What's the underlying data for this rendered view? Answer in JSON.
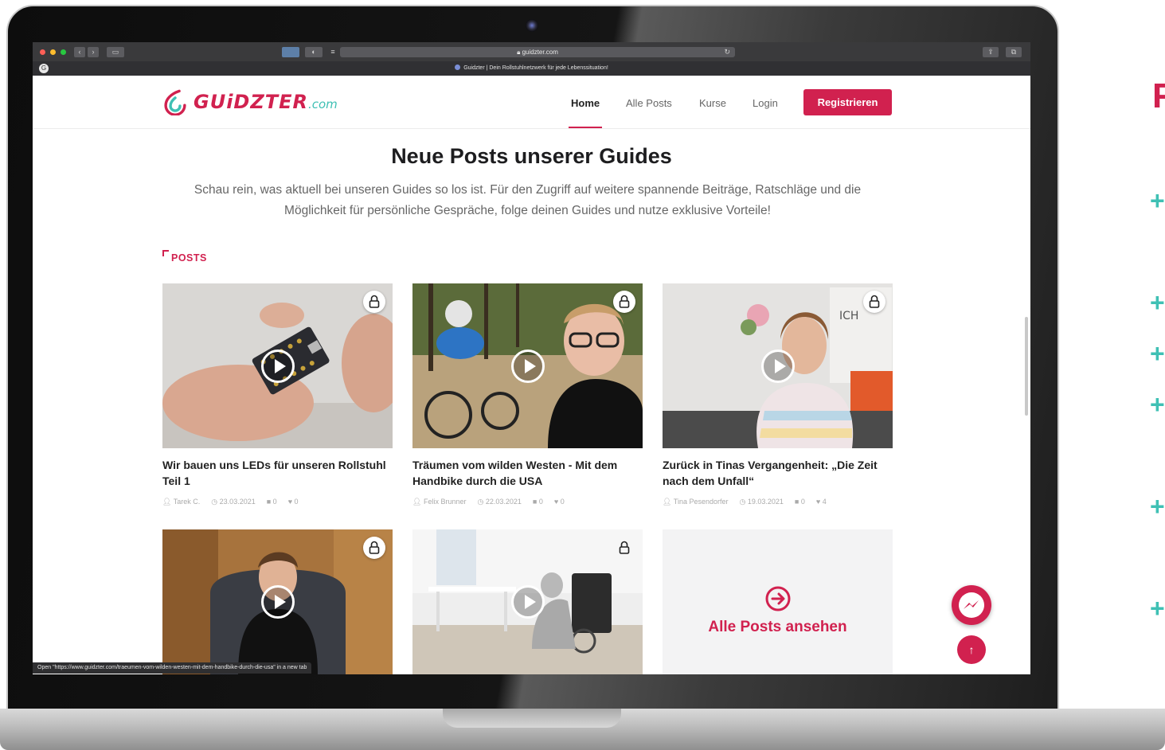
{
  "browser": {
    "url": "guidzter.com",
    "tab_title": "Guidzter | Dein Rollstuhlnetzwerk für jede Lebenssituation!",
    "status_url": "Open \"https://www.guidzter.com/traeumen-vom-wilden-westen-mit-dem-handbike-durch-die-usa\" in a new tab"
  },
  "nav": {
    "logo_text": "GUiDZTER",
    "logo_suffix": ".com",
    "links": [
      "Home",
      "Alle Posts",
      "Kurse",
      "Login"
    ],
    "active": "Home",
    "register_label": "Registrieren"
  },
  "hero": {
    "title": "Neue Posts unserer Guides",
    "subtitle": "Schau rein, was aktuell bei unseren Guides so los ist. Für den Zugriff auf weitere spannende Beiträge, Ratschläge und die Möglichkeit für persönliche Gespräche, folge deinen Guides und nutze exklusive Vorteile!"
  },
  "section_label": "POSTS",
  "posts": [
    {
      "title": "Wir bauen uns LEDs für unseren Rollstuhl Teil 1",
      "author": "Tarek C.",
      "date": "23.03.2021",
      "comments": "0",
      "likes": "0"
    },
    {
      "title": "Träumen vom wilden Westen - Mit dem Handbike durch die USA",
      "author": "Felix Brunner",
      "date": "22.03.2021",
      "comments": "0",
      "likes": "0"
    },
    {
      "title": "Zurück in Tinas Vergangenheit: „Die Zeit nach dem Unfall“",
      "author": "Tina Pesendorfer",
      "date": "19.03.2021",
      "comments": "0",
      "likes": "4"
    }
  ],
  "poster_text": "ICH SCHMEISS' ALLES HIN UND WERDE",
  "alle_posts_label": "Alle Posts ansehen",
  "colors": {
    "brand": "#d1214f",
    "accent": "#3fc0b4"
  },
  "icons": [
    "lock-icon",
    "play-icon",
    "messenger-icon",
    "arrow-up-icon",
    "arrow-right-circle-icon",
    "user-icon",
    "clock-icon",
    "comment-icon",
    "heart-icon"
  ]
}
